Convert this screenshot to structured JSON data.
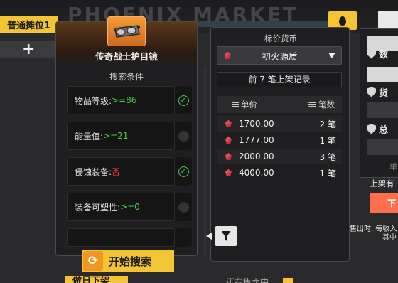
{
  "background": {
    "title_text": "PHOENIX MARKET",
    "market_tab": "普通摊位1",
    "add_label": "+",
    "start_search": "开始搜索",
    "bottom_left": "做日下架",
    "bottom_center": "正在售卖中",
    "right_edge": {
      "labels": [
        "数",
        "货",
        "总"
      ],
      "hint": "单",
      "listed_text": "上架有",
      "orange_button": "下",
      "notice_line1": "售出时, 每收入",
      "notice_line2": "其中"
    }
  },
  "item": {
    "name": "传奇战士护目镜",
    "icon": "goggles-icon"
  },
  "search": {
    "title": "搜索条件",
    "filters": [
      {
        "label": "物品等级:",
        "value": ">=86",
        "value_color": "green",
        "checked": true
      },
      {
        "label": "能量值:",
        "value": ">=21",
        "value_color": "green",
        "checked": false
      },
      {
        "label": "侵蚀装备:",
        "value": "否",
        "value_color": "red",
        "checked": true
      },
      {
        "label": "装备可塑性:",
        "value": ">=0",
        "value_color": "green",
        "checked": false
      }
    ]
  },
  "currency": {
    "label": "标价货币",
    "selected": "初火源质",
    "icon": "red-crystal-icon"
  },
  "records": {
    "label": "前 7 笔上架记录",
    "header_price": "单价",
    "header_count": "笔数",
    "rows": [
      {
        "price": "1700.00",
        "count": "2 笔"
      },
      {
        "price": "1777.00",
        "count": "1 笔"
      },
      {
        "price": "2000.00",
        "count": "3 笔"
      },
      {
        "price": "4000.00",
        "count": "1 笔"
      }
    ]
  },
  "colors": {
    "accent_yellow": "#f3c433",
    "panel_bg": "#1f1f21",
    "green_value": "#4cc84c",
    "red_value": "#e33b3b",
    "orange": "#ff6f4d"
  }
}
